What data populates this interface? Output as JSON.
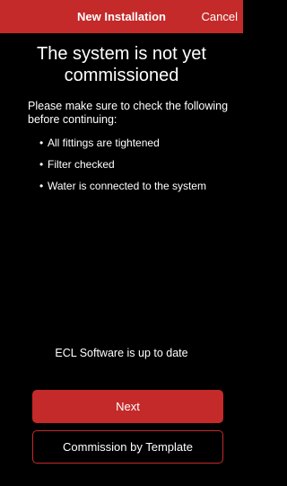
{
  "header": {
    "title": "New Installation",
    "cancel_label": "Cancel"
  },
  "main": {
    "heading": "The system is not yet commissioned",
    "intro": "Please make sure to check the following before continuing:",
    "bullet_glyph": "•",
    "checklist": [
      "All fittings are tightened",
      "Filter checked",
      "Water is connected to the system"
    ],
    "status": "ECL Software is up to date"
  },
  "actions": {
    "next_label": "Next",
    "template_label": "Commission by Template"
  },
  "colors": {
    "accent": "#c42a2a",
    "background": "#000000",
    "text": "#ffffff"
  }
}
